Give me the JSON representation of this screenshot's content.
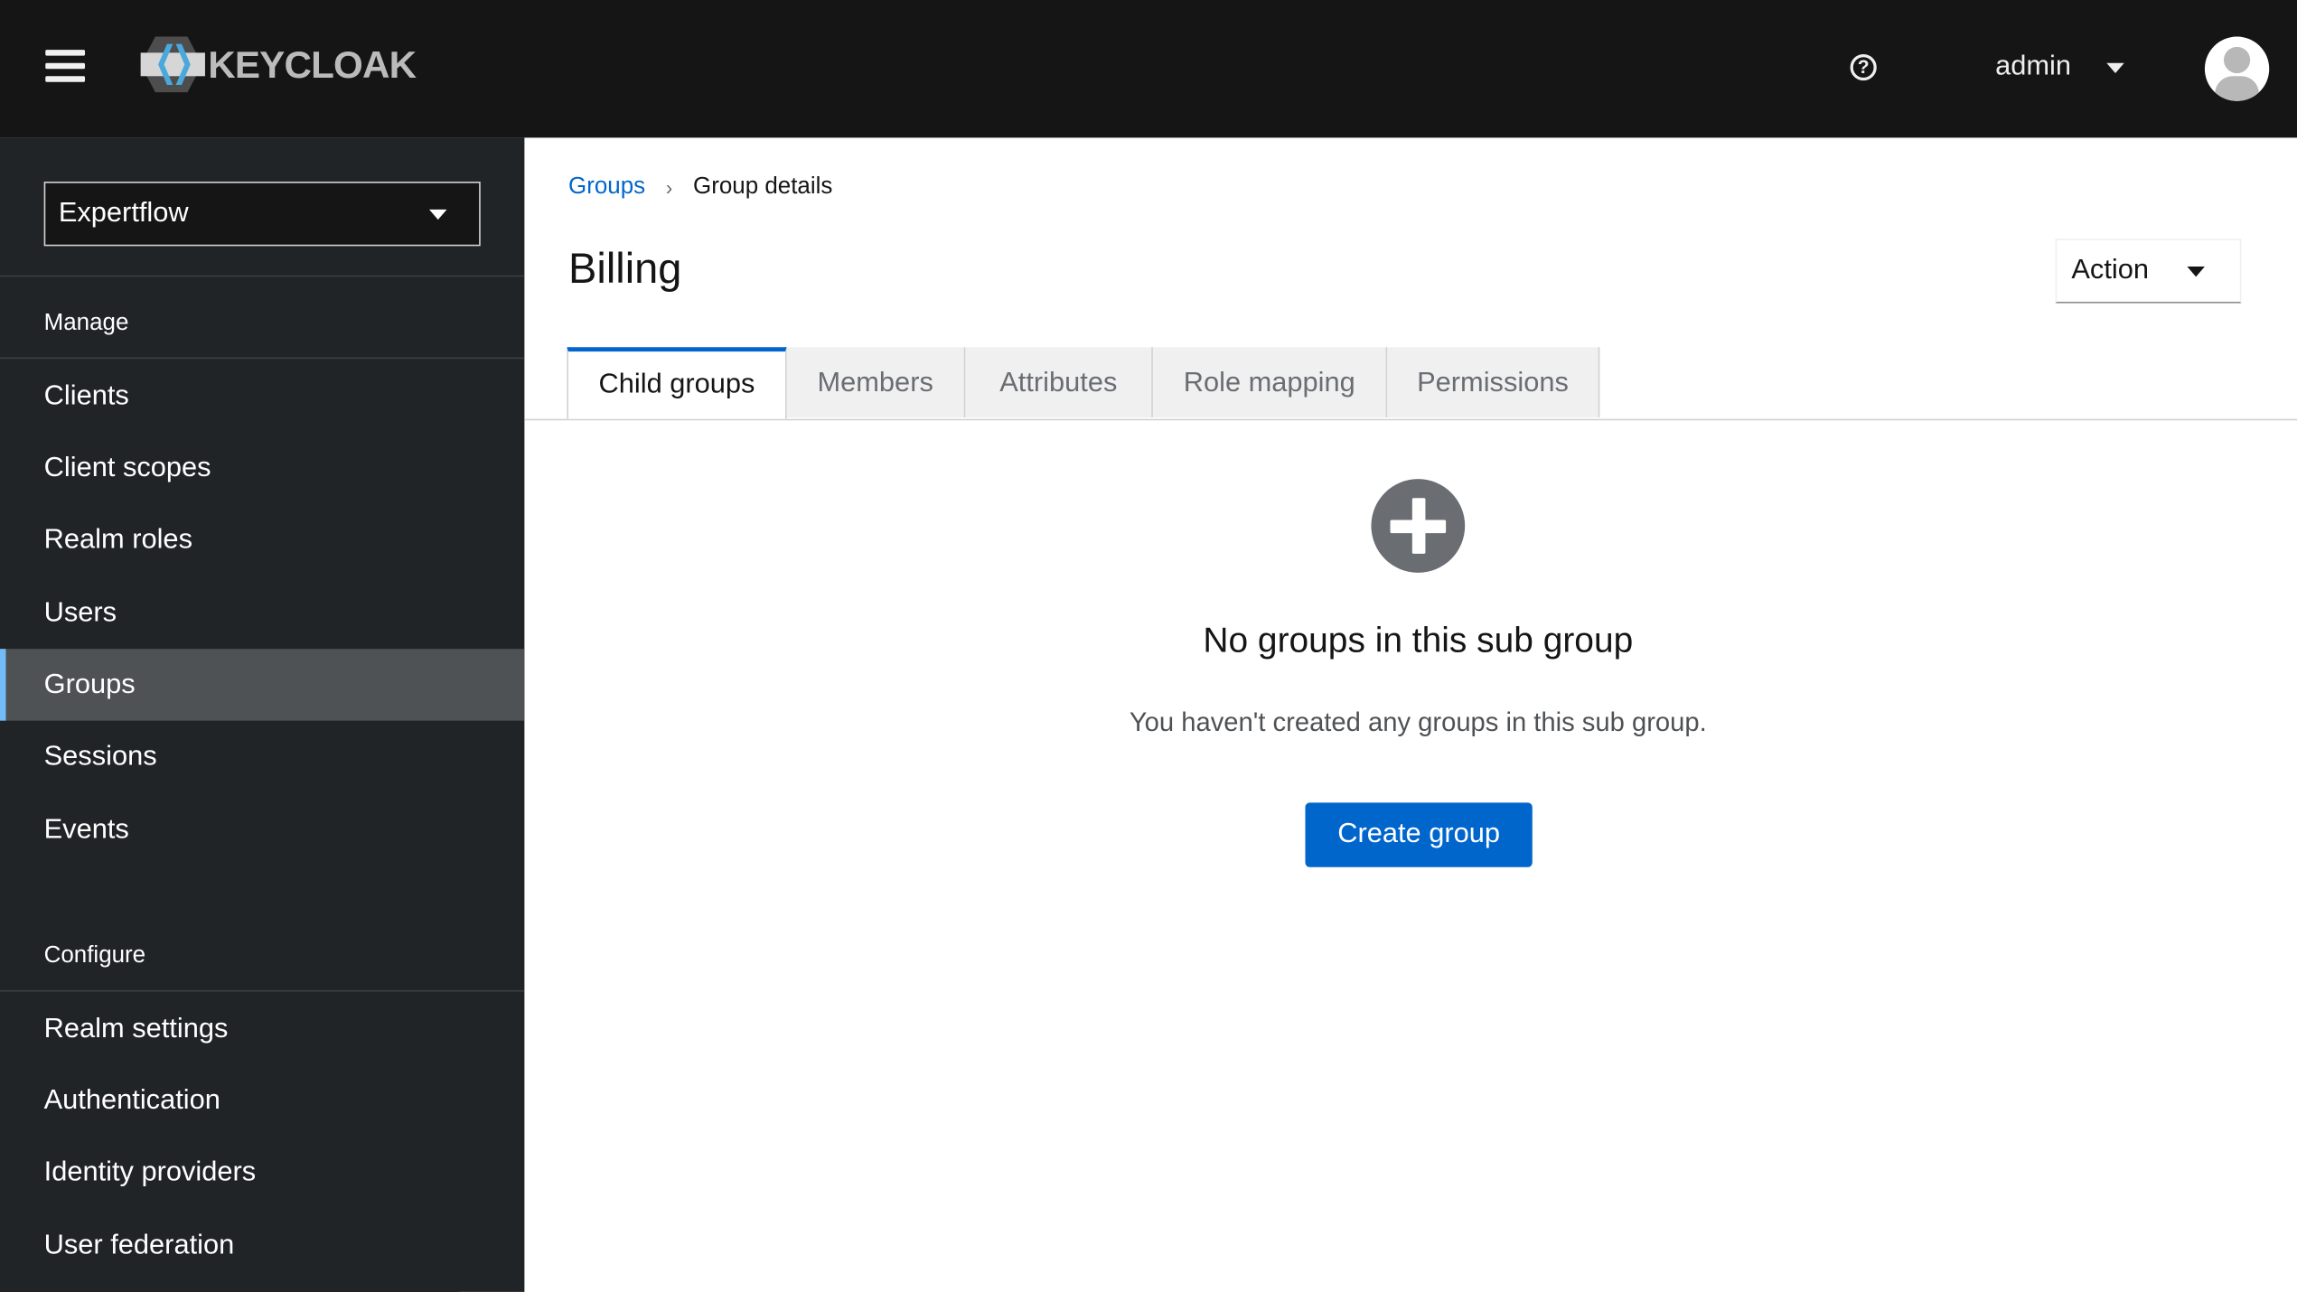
{
  "header": {
    "logo_text": "KEYCLOAK",
    "user": "admin",
    "icons": [
      "menu-icon",
      "help-icon",
      "caret-down-icon",
      "avatar"
    ]
  },
  "sidebar": {
    "realm": "Expertflow",
    "manage_label": "Manage",
    "manage_items": [
      "Clients",
      "Client scopes",
      "Realm roles",
      "Users",
      "Groups",
      "Sessions",
      "Events"
    ],
    "configure_label": "Configure",
    "configure_items": [
      "Realm settings",
      "Authentication",
      "Identity providers",
      "User federation"
    ],
    "active": "Groups"
  },
  "breadcrumb": {
    "parent": "Groups",
    "current": "Group details"
  },
  "page": {
    "title": "Billing",
    "action_label": "Action"
  },
  "tabs": [
    "Child groups",
    "Members",
    "Attributes",
    "Role mapping",
    "Permissions"
  ],
  "empty_state": {
    "title": "No groups in this sub group",
    "body": "You haven't created any groups in this sub group.",
    "button": "Create group"
  },
  "colors": {
    "accent": "#0066cc",
    "sidebar": "#212427",
    "topbar": "#151515"
  }
}
